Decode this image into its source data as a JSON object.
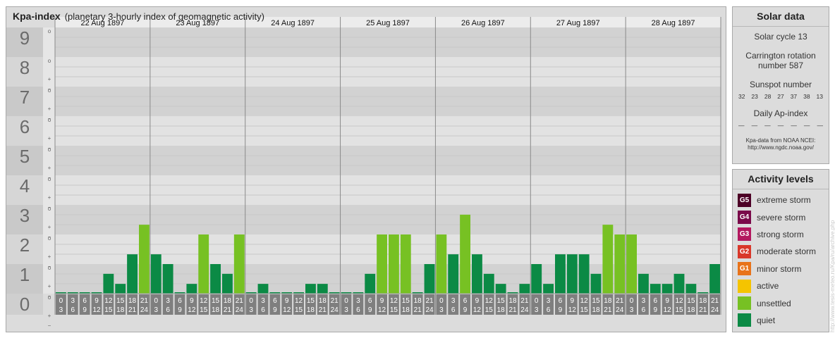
{
  "header": {
    "title": "Kpa-index",
    "subtitle": "(planetary 3-hourly index of geomagnetic activity)"
  },
  "chart_data": {
    "type": "bar",
    "title": "Kpa-index",
    "subtitle": "(planetary 3-hourly index of geomagnetic activity)",
    "ylim": [
      0,
      9
    ],
    "y_ticks": [
      "0",
      "1",
      "2",
      "3",
      "4",
      "5",
      "6",
      "7",
      "8",
      "9"
    ],
    "y_minor_ticks": [
      "o",
      "+",
      "−"
    ],
    "days": [
      "22 Aug 1897",
      "23 Aug 1897",
      "24 Aug 1897",
      "25 Aug 1897",
      "26 Aug 1897",
      "27 Aug 1897",
      "28 Aug 1897"
    ],
    "interval_labels": [
      [
        "0",
        "3"
      ],
      [
        "3",
        "6"
      ],
      [
        "6",
        "9"
      ],
      [
        "9",
        "12"
      ],
      [
        "12",
        "15"
      ],
      [
        "15",
        "18"
      ],
      [
        "18",
        "21"
      ],
      [
        "21",
        "24"
      ]
    ],
    "values": [
      [
        0,
        0,
        0,
        0,
        0.67,
        0.33,
        1.33,
        2.33
      ],
      [
        1.33,
        1,
        0,
        0.33,
        2,
        1,
        0.67,
        2
      ],
      [
        0,
        0.33,
        0,
        0,
        0,
        0.33,
        0.33,
        0
      ],
      [
        0,
        0,
        0.67,
        2,
        2,
        2,
        0,
        1
      ],
      [
        2,
        1.33,
        2.67,
        1.33,
        0.67,
        0.33,
        0,
        0.33
      ],
      [
        1,
        0.33,
        1.33,
        1.33,
        1.33,
        0.67,
        2.33,
        2
      ],
      [
        2,
        0.67,
        0.33,
        0.33,
        0.67,
        0.33,
        0,
        1
      ]
    ],
    "colors": {
      "quiet": "#0b8a45",
      "unsettled": "#77c123"
    },
    "grid": true
  },
  "solar": {
    "title": "Solar data",
    "cycle": "Solar cycle 13",
    "carrington_line1": "Carrington rotation",
    "carrington_line2": "number 587",
    "sunspot_title": "Sunspot number",
    "sunspots": [
      "32",
      "23",
      "28",
      "27",
      "37",
      "38",
      "13"
    ],
    "ap_title": "Daily Ap-index",
    "ap_values": [
      "—",
      "—",
      "—",
      "—",
      "—",
      "—",
      "—"
    ],
    "source_line1": "Kpa-data from NOAA NCEI:",
    "source_line2": "http://www.ngdc.noaa.gov/"
  },
  "activity": {
    "title": "Activity levels",
    "levels": [
      {
        "badge": "G5",
        "label": "extreme storm",
        "color": "#4d0026"
      },
      {
        "badge": "G4",
        "label": "severe storm",
        "color": "#7a0a4a"
      },
      {
        "badge": "G3",
        "label": "strong storm",
        "color": "#b3185f"
      },
      {
        "badge": "G2",
        "label": "moderate storm",
        "color": "#d9382a"
      },
      {
        "badge": "G1",
        "label": "minor storm",
        "color": "#e8731a"
      },
      {
        "badge": "",
        "label": "active",
        "color": "#f5c400"
      },
      {
        "badge": "",
        "label": "unsettled",
        "color": "#77c123"
      },
      {
        "badge": "",
        "label": "quiet",
        "color": "#0b8a45"
      }
    ]
  },
  "credit": "http://www.tesis-meteo.ru/Kpa/ru/archive.php"
}
